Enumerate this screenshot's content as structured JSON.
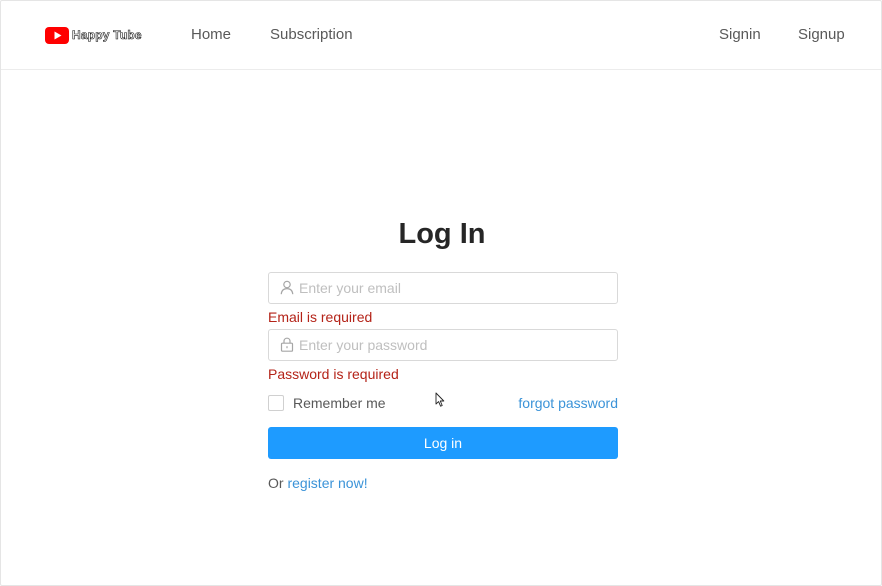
{
  "header": {
    "logo_text": "Happy Tube",
    "nav": {
      "home": "Home",
      "subscription": "Subscription",
      "signin": "Signin",
      "signup": "Signup"
    }
  },
  "login": {
    "title": "Log In",
    "email": {
      "value": "",
      "placeholder": "Enter your email",
      "error": "Email is required"
    },
    "password": {
      "value": "",
      "placeholder": "Enter your password",
      "error": "Password is required"
    },
    "remember_label": "Remember me",
    "remember_checked": false,
    "forgot_label": "forgot password",
    "submit_label": "Log in",
    "register_prefix": "Or",
    "register_link": "register now!"
  },
  "icons": {
    "logo": "youtube-play-icon",
    "email": "user-icon",
    "password": "lock-icon",
    "cursor": "mouse-pointer-icon"
  },
  "colors": {
    "accent": "#1e9bff",
    "link": "#3b93d8",
    "error": "#b42318",
    "brand_red": "#ff0000"
  }
}
